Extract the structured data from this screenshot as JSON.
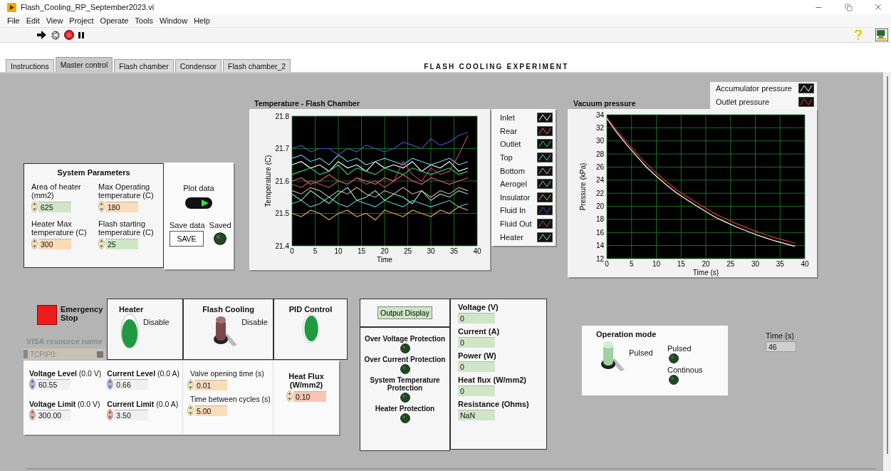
{
  "window": {
    "title": "Flash_Cooling_RP_September2023.vi"
  },
  "menu": [
    "File",
    "Edit",
    "View",
    "Project",
    "Operate",
    "Tools",
    "Window",
    "Help"
  ],
  "tabs": [
    {
      "label": "Instructions",
      "selected": false
    },
    {
      "label": "Master control",
      "selected": true
    },
    {
      "label": "Flash chamber",
      "selected": false
    },
    {
      "label": "Condensor",
      "selected": false
    },
    {
      "label": "Flash chamber_2",
      "selected": false
    }
  ],
  "panel_title": "FLASH COOLING EXPERIMENT",
  "system_parameters": {
    "title": "System Parameters",
    "fields": [
      {
        "label": "Area of heater (mm2)",
        "value": "625",
        "color": "#cfe6c6"
      },
      {
        "label": "Max Operating temperature (C)",
        "value": "180",
        "color": "#fbdcb8"
      },
      {
        "label": "Heater Max temperature (C)",
        "value": "300",
        "color": "#fbdcb8"
      },
      {
        "label": "Flash starting temperature (C)",
        "value": "25",
        "color": "#cfe6c6"
      }
    ]
  },
  "plot_data": {
    "label": "Plot data",
    "on": true
  },
  "save": {
    "label": "Save data",
    "button": "SAVE"
  },
  "saved": {
    "label": "Saved",
    "on": false
  },
  "temperature_chart": {
    "chart_data": {
      "type": "line",
      "title": "Temperature - Flash Chamber",
      "xlabel": "Time",
      "ylabel": "Temperature  (C)",
      "x": [
        0,
        2,
        4,
        6,
        8,
        10,
        12,
        14,
        16,
        18,
        20,
        22,
        24,
        26,
        28,
        30,
        32,
        34,
        36,
        38
      ],
      "xlim": [
        0,
        40
      ],
      "ylim": [
        21.4,
        21.8
      ],
      "xticks": [
        0,
        5,
        10,
        15,
        20,
        25,
        30,
        35,
        40
      ],
      "yticks": [
        21.4,
        21.5,
        21.6,
        21.7,
        21.8
      ],
      "series": [
        {
          "name": "Inlet",
          "color": "#ffffff",
          "values": [
            21.65,
            21.66,
            21.64,
            21.65,
            21.63,
            21.66,
            21.64,
            21.65,
            21.63,
            21.66,
            21.64,
            21.65,
            21.64,
            21.66,
            21.63,
            21.65,
            21.64,
            21.66,
            21.63,
            21.64
          ]
        },
        {
          "name": "Rear",
          "color": "#e05a6a",
          "values": [
            21.6,
            21.61,
            21.59,
            21.6,
            21.62,
            21.6,
            21.59,
            21.61,
            21.6,
            21.59,
            21.61,
            21.6,
            21.62,
            21.6,
            21.59,
            21.61,
            21.6,
            21.59,
            21.6,
            21.61
          ]
        },
        {
          "name": "Outlet",
          "color": "#30d060",
          "values": [
            21.62,
            21.63,
            21.64,
            21.62,
            21.63,
            21.65,
            21.62,
            21.64,
            21.63,
            21.62,
            21.64,
            21.63,
            21.62,
            21.64,
            21.63,
            21.62,
            21.63,
            21.64,
            21.62,
            21.63
          ]
        },
        {
          "name": "Top",
          "color": "#70c8e0",
          "values": [
            21.67,
            21.68,
            21.66,
            21.67,
            21.65,
            21.68,
            21.66,
            21.67,
            21.65,
            21.66,
            21.67,
            21.66,
            21.65,
            21.67,
            21.66,
            21.65,
            21.66,
            21.67,
            21.65,
            21.66
          ]
        },
        {
          "name": "Bottom",
          "color": "#c8a890",
          "values": [
            21.57,
            21.56,
            21.58,
            21.57,
            21.55,
            21.57,
            21.56,
            21.58,
            21.56,
            21.55,
            21.57,
            21.56,
            21.58,
            21.56,
            21.57,
            21.55,
            21.57,
            21.56,
            21.58,
            21.57
          ]
        },
        {
          "name": "Aerogel",
          "color": "#60c8c8",
          "values": [
            21.53,
            21.54,
            21.52,
            21.53,
            21.55,
            21.53,
            21.52,
            21.54,
            21.53,
            21.52,
            21.54,
            21.53,
            21.52,
            21.54,
            21.53,
            21.52,
            21.53,
            21.54,
            21.52,
            21.53
          ]
        },
        {
          "name": "Insulator",
          "color": "#d8a050",
          "values": [
            21.5,
            21.49,
            21.51,
            21.5,
            21.48,
            21.5,
            21.51,
            21.49,
            21.5,
            21.48,
            21.51,
            21.5,
            21.49,
            21.51,
            21.5,
            21.49,
            21.51,
            21.5,
            21.52,
            21.51
          ]
        },
        {
          "name": "Fluid In",
          "color": "#4a4ac0",
          "values": [
            21.7,
            21.71,
            21.69,
            21.7,
            21.7,
            21.68,
            21.7,
            21.69,
            21.71,
            21.7,
            21.69,
            21.7,
            21.72,
            21.71,
            21.7,
            21.73,
            21.71,
            21.72,
            21.74,
            21.75
          ]
        },
        {
          "name": "Fluid Out",
          "color": "#b04868",
          "values": [
            21.59,
            21.58,
            21.6,
            21.59,
            21.58,
            21.6,
            21.59,
            21.61,
            21.59,
            21.6,
            21.58,
            21.6,
            21.66,
            21.62,
            21.6,
            21.64,
            21.62,
            21.63,
            21.68,
            21.74
          ]
        },
        {
          "name": "Heater",
          "color": "#88e0d0",
          "values": [
            21.56,
            21.54,
            21.57,
            21.55,
            21.53,
            21.56,
            21.58,
            21.54,
            21.55,
            21.57,
            21.54,
            21.56,
            21.55,
            21.53,
            21.57,
            21.54,
            21.56,
            21.55,
            21.57,
            21.56
          ]
        }
      ],
      "grid": true
    }
  },
  "pressure_chart": {
    "chart_data": {
      "type": "line",
      "title": "Vacuum pressure",
      "xlabel": "Time (s)",
      "ylabel": "Pressure (kPa)",
      "x": [
        0,
        2,
        4,
        6,
        8,
        10,
        12,
        14,
        16,
        18,
        20,
        22,
        24,
        26,
        28,
        30,
        32,
        34,
        36,
        38
      ],
      "xlim": [
        0,
        40
      ],
      "ylim": [
        12,
        34
      ],
      "xticks": [
        0,
        5,
        10,
        15,
        20,
        25,
        30,
        35,
        40
      ],
      "yticks": [
        12,
        14,
        16,
        18,
        20,
        22,
        24,
        26,
        28,
        30,
        32,
        34
      ],
      "series": [
        {
          "name": "Accumulator pressure",
          "color": "#ffffff",
          "values": [
            33.4,
            31.3,
            29.4,
            27.7,
            26.0,
            24.6,
            23.3,
            22.1,
            21.1,
            20.1,
            19.2,
            18.3,
            17.6,
            16.9,
            16.3,
            15.7,
            15.2,
            14.7,
            14.3,
            13.9
          ]
        },
        {
          "name": "Outlet pressure",
          "color": "#e03030",
          "values": [
            33.6,
            31.6,
            29.8,
            28.1,
            26.5,
            25.1,
            23.8,
            22.6,
            21.6,
            20.6,
            19.7,
            18.8,
            18.1,
            17.4,
            16.8,
            16.2,
            15.7,
            15.2,
            14.8,
            14.4
          ]
        }
      ],
      "grid": true
    }
  },
  "emergency_stop": {
    "label": "Emergency Stop"
  },
  "switches": [
    {
      "kind": "rocker",
      "label": "Heater",
      "state_label": "Disable",
      "on": true
    },
    {
      "kind": "toggle",
      "label": "Flash Cooling",
      "state_label": "Disable",
      "on": false
    },
    {
      "kind": "button",
      "label": "PID Control",
      "on": true
    }
  ],
  "visa": {
    "label": "VISA resource name",
    "value": "TCPIP0:",
    "disabled": true
  },
  "power_supply": [
    {
      "label": "**Voltage Level** (0.0 V)",
      "value": "60.55",
      "color": "#a9b4e0"
    },
    {
      "label": "**Current Level** (0.0 A)",
      "value": "0.66",
      "color": "#a9b4e0"
    },
    {
      "label": "**Voltage Limit** (0.0 V)",
      "value": "300.00",
      "color": "#f0a898"
    },
    {
      "label": "**Current Limit** (0.0 A)",
      "value": "3.50",
      "color": "#f0a898"
    }
  ],
  "valve": [
    {
      "label": "Valve opening time (s)",
      "value": "0.01"
    },
    {
      "label": "Time between cycles (s)",
      "value": "5.00"
    }
  ],
  "heat_flux": {
    "label": "Heat Flux (W/mm2)",
    "value": "0.10"
  },
  "output_display": {
    "button": "Output Display"
  },
  "protections": [
    {
      "label": "Over Voltage Protection",
      "on": false
    },
    {
      "label": "Over Current Protection",
      "on": false
    },
    {
      "label": "System Temperature Protection",
      "on": false
    },
    {
      "label": "Heater Protection",
      "on": false
    }
  ],
  "readings": [
    {
      "label": "Voltage (V)",
      "value": "0"
    },
    {
      "label": "Current (A)",
      "value": "0"
    },
    {
      "label": "Power (W)",
      "value": "0"
    },
    {
      "label": "Heat flux (W/mm2)",
      "value": "0"
    },
    {
      "label": "Resistance (Ohms)",
      "value": "NaN"
    }
  ],
  "operation_mode": {
    "title": "Operation mode",
    "switch_label": "Pulsed",
    "on": true,
    "leds": [
      {
        "label": "Pulsed",
        "on": false
      },
      {
        "label": "Continous",
        "on": false
      }
    ]
  },
  "time": {
    "label": "Time (s)",
    "value": "46"
  }
}
